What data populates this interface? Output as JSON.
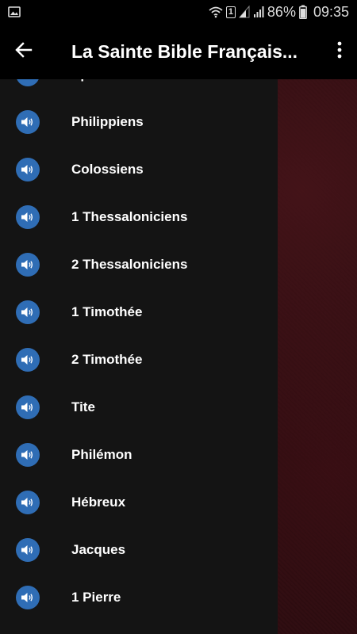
{
  "status_bar": {
    "battery": "86%",
    "time": "09:35",
    "sim_slot": "1"
  },
  "app_bar": {
    "title": "La Sainte Bible Français..."
  },
  "books": [
    {
      "label": "Ephésiens"
    },
    {
      "label": "Philippiens"
    },
    {
      "label": "Colossiens"
    },
    {
      "label": "1 Thessaloniciens"
    },
    {
      "label": "2 Thessaloniciens"
    },
    {
      "label": "1 Timothée"
    },
    {
      "label": "2 Timothée"
    },
    {
      "label": "Tite"
    },
    {
      "label": "Philémon"
    },
    {
      "label": "Hébreux"
    },
    {
      "label": "Jacques"
    },
    {
      "label": "1 Pierre"
    }
  ],
  "colors": {
    "speaker_badge": "#2f6db5",
    "drawer_bg": "#141414",
    "backdrop": "#2a0b0f"
  }
}
